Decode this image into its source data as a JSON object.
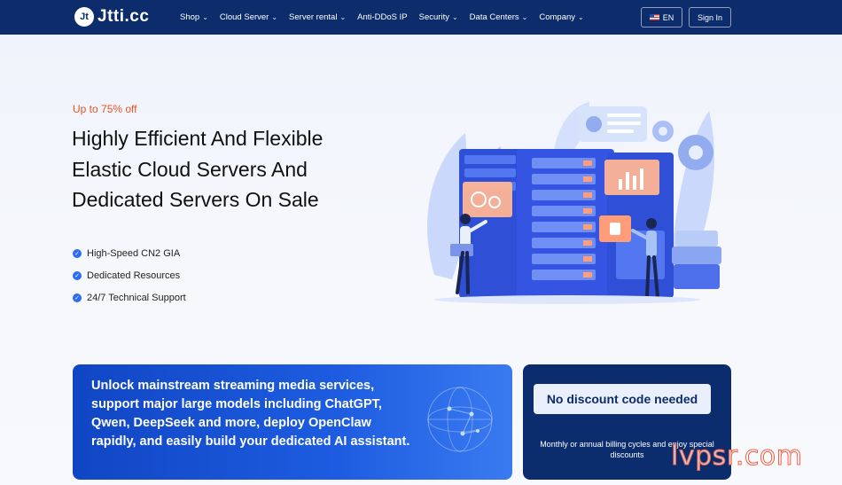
{
  "brand": {
    "logo_mark": "Jt",
    "name": "Jtti.cc"
  },
  "nav": {
    "items": [
      {
        "label": "Shop",
        "has_dropdown": true
      },
      {
        "label": "Cloud Server",
        "has_dropdown": true
      },
      {
        "label": "Server rental",
        "has_dropdown": true
      },
      {
        "label": "Anti-DDoS IP",
        "has_dropdown": false
      },
      {
        "label": "Security",
        "has_dropdown": true
      },
      {
        "label": "Data Centers",
        "has_dropdown": true
      },
      {
        "label": "Company",
        "has_dropdown": true
      }
    ],
    "language_label": "EN",
    "signin_label": "Sign In"
  },
  "hero": {
    "promo": "Up to 75% off",
    "headline_lines": [
      "Highly Efficient And Flexible",
      "Elastic Cloud Servers And",
      "Dedicated Servers On Sale"
    ],
    "features": [
      "High-Speed CN2 GIA",
      "Dedicated Resources",
      "24/7 Technical Support"
    ]
  },
  "cards": {
    "ai_text": "Unlock mainstream streaming media services, support major large models including ChatGPT, Qwen, DeepSeek and more, deploy OpenClaw rapidly, and easily build your dedicated AI assistant.",
    "discount_title": "No discount code needed",
    "discount_subtitle": "Monthly or annual billing cycles and enjoy special discounts"
  },
  "watermark": "lvpsr.com",
  "colors": {
    "nav_bg": "#0d2c6b",
    "promo": "#e8541e",
    "accent": "#2c6cf0",
    "card_code_bg": "#0b2d6e"
  }
}
